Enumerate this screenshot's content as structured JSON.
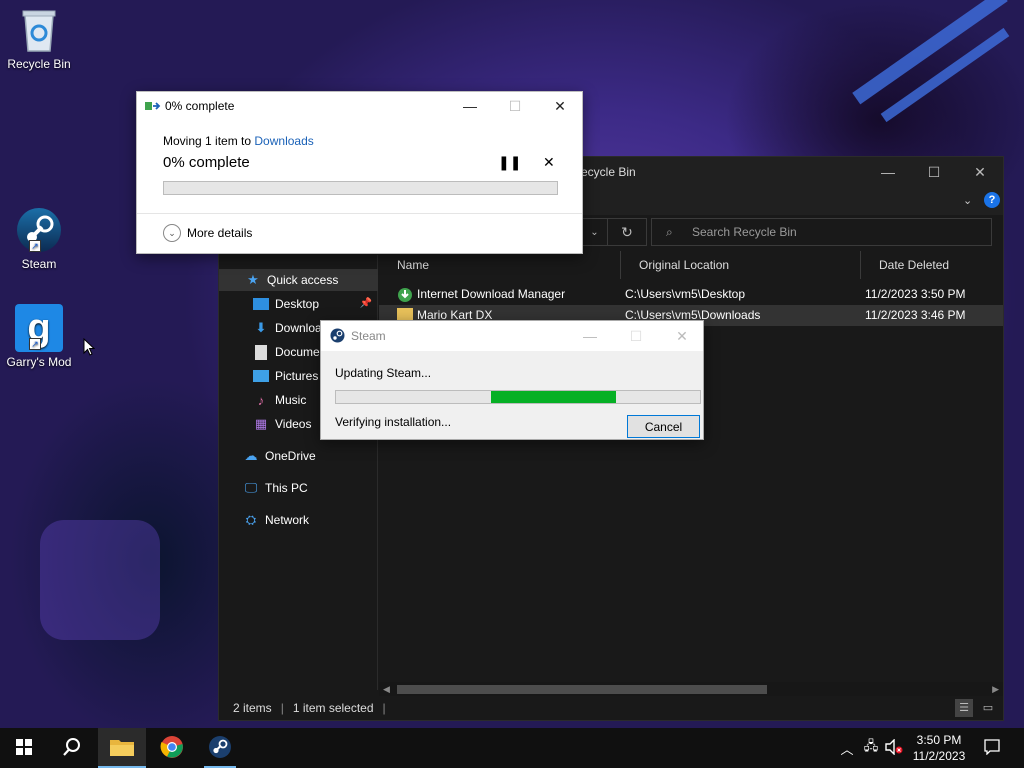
{
  "desktop": {
    "icons": [
      {
        "label": "Recycle Bin"
      },
      {
        "label": "Steam"
      },
      {
        "label": "Garry's Mod"
      }
    ]
  },
  "explorer": {
    "title": "Recycle Bin",
    "title_visible": "ecycle Bin",
    "search_placeholder": "Search Recycle Bin",
    "nav": [
      {
        "label": "Quick access"
      },
      {
        "label": "Desktop"
      },
      {
        "label": "Downloads",
        "visible": "Downloa"
      },
      {
        "label": "Documents",
        "visible": "Documen"
      },
      {
        "label": "Pictures"
      },
      {
        "label": "Music"
      },
      {
        "label": "Videos"
      },
      {
        "label": "OneDrive"
      },
      {
        "label": "This PC"
      },
      {
        "label": "Network"
      }
    ],
    "columns": {
      "name": "Name",
      "location": "Original Location",
      "deleted": "Date Deleted"
    },
    "rows": [
      {
        "name": "Internet Download Manager",
        "location": "C:\\Users\\vm5\\Desktop",
        "deleted": "11/2/2023 3:50 PM"
      },
      {
        "name": "Mario Kart DX",
        "location": "C:\\Users\\vm5\\Downloads",
        "deleted": "11/2/2023 3:46 PM"
      }
    ],
    "status": {
      "items": "2 items",
      "selected": "1 item selected"
    }
  },
  "copy_dialog": {
    "title": "0% complete",
    "moving_prefix": "Moving 1 item to",
    "destination": "Downloads",
    "percent_label": "0% complete",
    "progress": 0,
    "more_details": "More details"
  },
  "steam_dialog": {
    "title": "Steam",
    "status": "Updating Steam...",
    "substatus": "Verifying installation...",
    "cancel_label": "Cancel",
    "progress_start": 0.425,
    "progress_end": 0.77
  },
  "taskbar": {
    "time": "3:50 PM",
    "date": "11/2/2023"
  },
  "colors": {
    "accent": "#0078d7",
    "progress_green": "#06b025",
    "link_blue": "#1b62b8",
    "explorer_bg": "#191919"
  }
}
